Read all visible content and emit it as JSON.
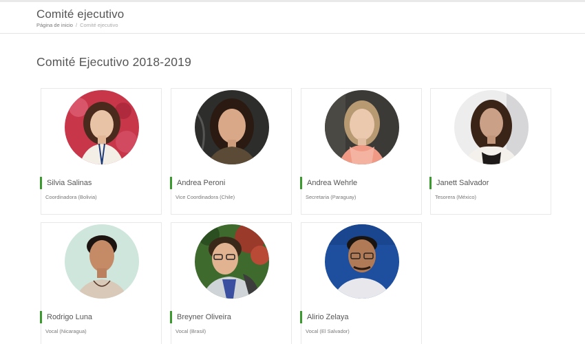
{
  "header": {
    "title": "Comité ejecutivo",
    "breadcrumb": {
      "home": "Página de inicio",
      "separator": "/",
      "current": "Comité ejecutivo"
    }
  },
  "section": {
    "title": "Comité Ejecutivo 2018-2019"
  },
  "accent_color": "#3a9a2e",
  "members": [
    {
      "name": "Silvia Salinas",
      "role": "Coordinadora (Bolivia)"
    },
    {
      "name": "Andrea Peroni",
      "role": "Vice Coordinadora (Chile)"
    },
    {
      "name": "Andrea Wehrle",
      "role": "Secretaria (Paraguay)"
    },
    {
      "name": "Janett Salvador",
      "role": "Tesorera (México)"
    },
    {
      "name": "Rodrigo Luna",
      "role": "Vocal (Nicaragua)"
    },
    {
      "name": "Breyner Oliveira",
      "role": "Vocal (Brasil)"
    },
    {
      "name": "Alirio Zelaya",
      "role": "Vocal (El Salvador)"
    }
  ]
}
